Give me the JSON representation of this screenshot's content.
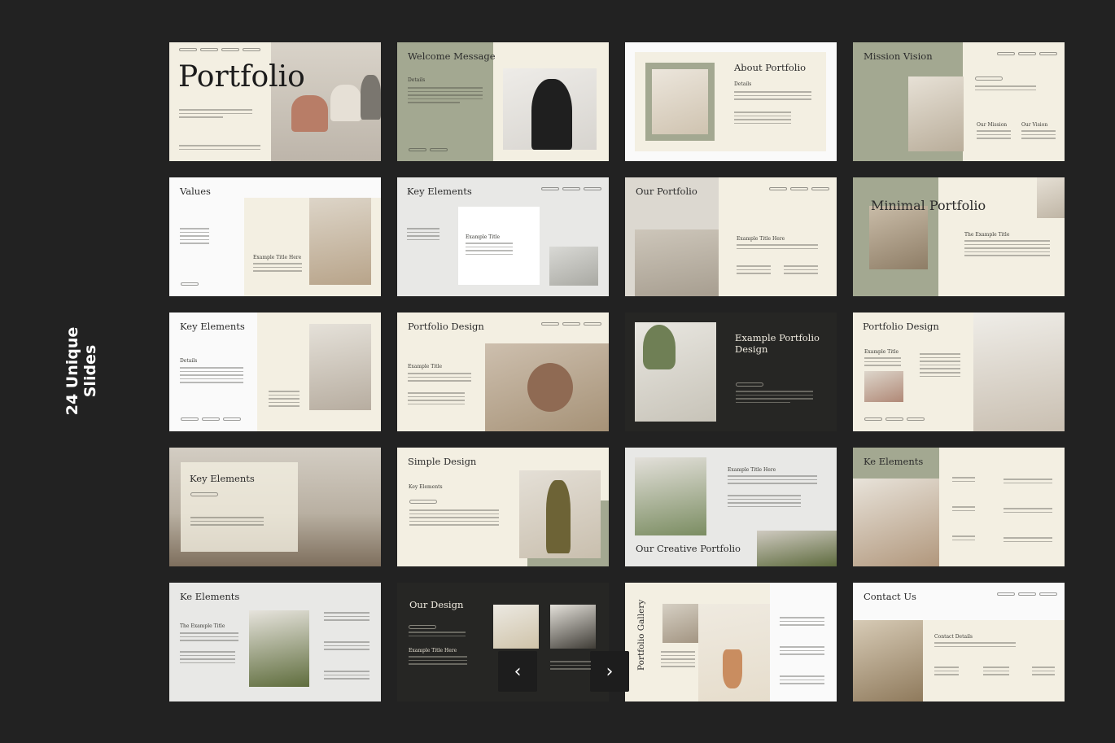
{
  "side_label": {
    "line1": "24 Unique",
    "line2": "Slides"
  },
  "colors": {
    "background": "#222222",
    "cream": "#f3efe2",
    "sage": "#a3a891",
    "dark_slide": "#262624",
    "white": "#fafafa"
  },
  "slides": [
    {
      "title": "Portfolio"
    },
    {
      "title": "Welcome Message",
      "details": "Details"
    },
    {
      "title": "About Portfolio",
      "details": "Details"
    },
    {
      "title": "Mission Vision",
      "mission": "Our Mission",
      "vision": "Our Vision"
    },
    {
      "title": "Values",
      "sub": "Example Title Here"
    },
    {
      "title": "Key Elements",
      "sub": "Example Title"
    },
    {
      "title": "Our Portfolio",
      "sub": "Example Title Here"
    },
    {
      "title": "Minimal Portfolio",
      "sub": "The Example Title"
    },
    {
      "title": "Key Elements",
      "details": "Details"
    },
    {
      "title": "Portfolio Design",
      "sub": "Example Title"
    },
    {
      "title": "Example Portfolio Design"
    },
    {
      "title": "Portfolio Design",
      "sub": "Example Title"
    },
    {
      "title": "Key Elements"
    },
    {
      "title": "Simple Design",
      "sub": "Key Elements"
    },
    {
      "title": "Our Creative Portfolio",
      "sub": "Example Title Here"
    },
    {
      "title": "Ke Elements"
    },
    {
      "title": "Ke Elements",
      "sub": "The Example Title"
    },
    {
      "title": "Our Design",
      "sub": "Example Title Here"
    },
    {
      "title": "Portfolio Gallery"
    },
    {
      "title": "Contact Us",
      "details": "Contact Details"
    }
  ],
  "nav": {
    "prev_icon": "chevron-left-icon",
    "next_icon": "chevron-right-icon",
    "prev": "‹",
    "next": "›"
  }
}
